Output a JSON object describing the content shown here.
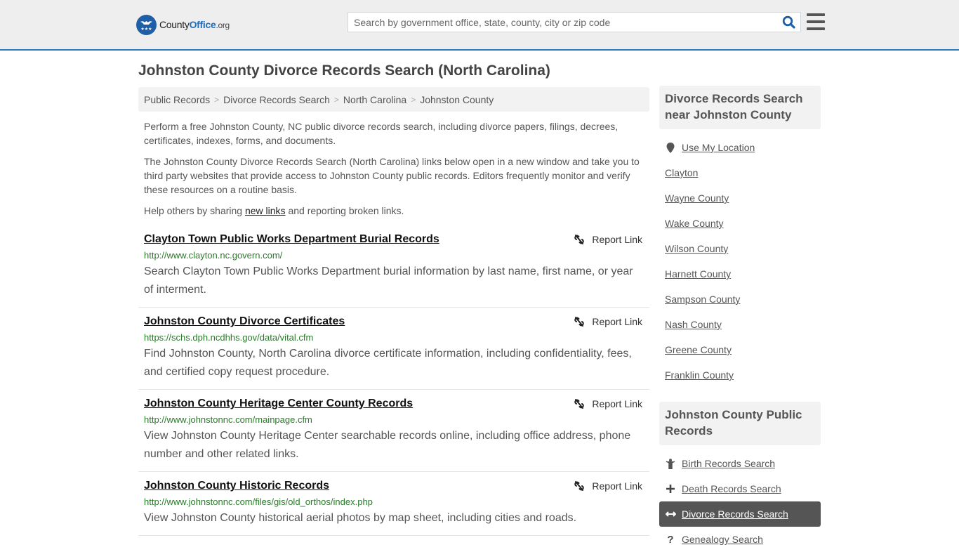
{
  "header": {
    "logo": {
      "name": "County",
      "name_bold": "Office",
      "tld": ".org"
    },
    "search": {
      "placeholder": "Search by government office, state, county, city or zip code",
      "value": ""
    },
    "icons": {
      "search": "search-icon",
      "menu": "hamburger-menu-icon"
    }
  },
  "page": {
    "title": "Johnston County Divorce Records Search (North Carolina)"
  },
  "breadcrumb": [
    {
      "label": "Public Records"
    },
    {
      "label": "Divorce Records Search"
    },
    {
      "label": "North Carolina"
    },
    {
      "label": "Johnston County"
    }
  ],
  "intro": {
    "p1": "Perform a free Johnston County, NC public divorce records search, including divorce papers, filings, decrees, certificates, indexes, forms, and documents.",
    "p2": "The Johnston County Divorce Records Search (North Carolina) links below open in a new window and take you to third party websites that provide access to Johnston County public records. Editors frequently monitor and verify these resources on a routine basis.",
    "p3_before": "Help others by sharing ",
    "p3_link": "new links",
    "p3_after": " and reporting broken links."
  },
  "results": [
    {
      "title": "Clayton Town Public Works Department Burial Records",
      "url": "http://www.clayton.nc.govern.com/",
      "description": "Search Clayton Town Public Works Department burial information by last name, first name, or year of interment.",
      "report_label": "Report Link"
    },
    {
      "title": "Johnston County Divorce Certificates",
      "url": "https://schs.dph.ncdhhs.gov/data/vital.cfm",
      "description": "Find Johnston County, North Carolina divorce certificate information, including confidentiality, fees, and certified copy request procedure.",
      "report_label": "Report Link"
    },
    {
      "title": "Johnston County Heritage Center County Records",
      "url": "http://www.johnstonnc.com/mainpage.cfm",
      "description": "View Johnston County Heritage Center searchable records online, including office address, phone number and other related links.",
      "report_label": "Report Link"
    },
    {
      "title": "Johnston County Historic Records",
      "url": "http://www.johnstonnc.com/files/gis/old_orthos/index.php",
      "description": "View Johnston County historical aerial photos by map sheet, including cities and roads.",
      "report_label": "Report Link"
    }
  ],
  "sidebar": {
    "nearby": {
      "heading": "Divorce Records Search near Johnston County",
      "use_location": "Use My Location",
      "items": [
        {
          "label": "Clayton"
        },
        {
          "label": "Wayne County"
        },
        {
          "label": "Wake County"
        },
        {
          "label": "Wilson County"
        },
        {
          "label": "Harnett County"
        },
        {
          "label": "Sampson County"
        },
        {
          "label": "Nash County"
        },
        {
          "label": "Greene County"
        },
        {
          "label": "Franklin County"
        }
      ]
    },
    "public_records": {
      "heading": "Johnston County Public Records",
      "items": [
        {
          "label": "Birth Records Search",
          "icon": "child-icon",
          "active": false
        },
        {
          "label": "Death Records Search",
          "icon": "plus-icon",
          "active": false
        },
        {
          "label": "Divorce Records Search",
          "icon": "arrows-horizontal-icon",
          "active": true
        },
        {
          "label": "Genealogy Search",
          "icon": "question-icon",
          "active": false
        }
      ]
    }
  },
  "colors": {
    "accent": "#2f7bbf",
    "url_green": "#2a7a2a",
    "active_bg": "#555555"
  }
}
